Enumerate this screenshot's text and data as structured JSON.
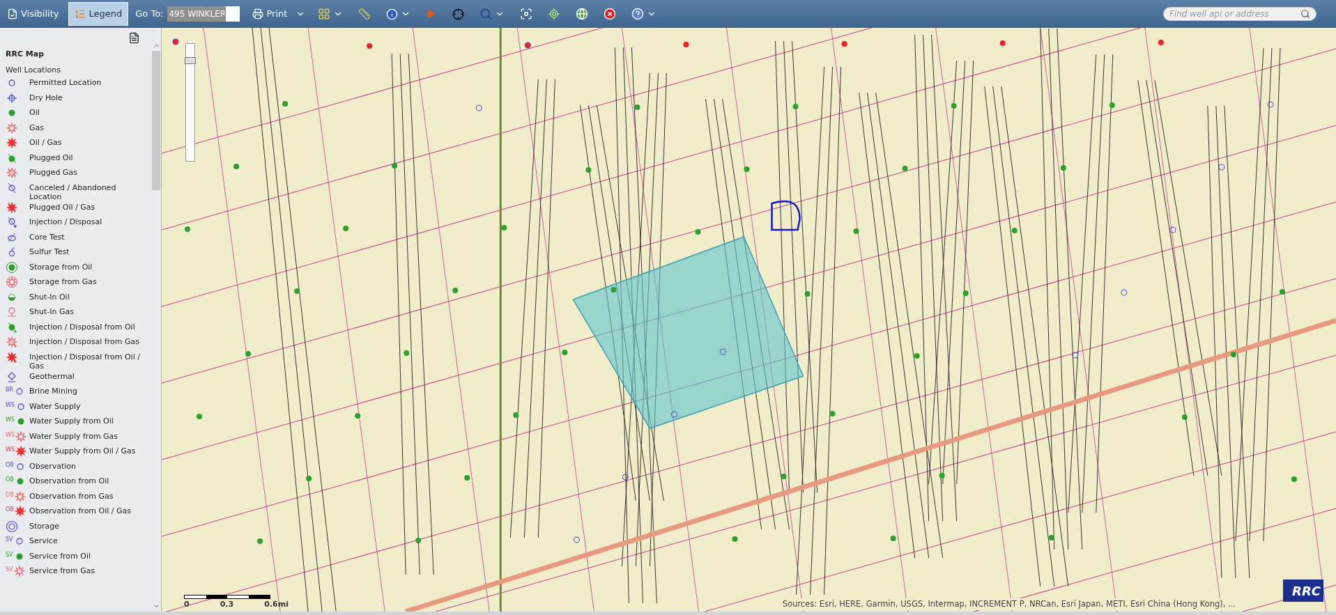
{
  "toolbar": {
    "tabs": [
      {
        "label": "Visibility",
        "kind": "visibility",
        "selected": false
      },
      {
        "label": "Legend",
        "kind": "legend",
        "selected": true
      }
    ],
    "goto": {
      "label": "Go To:",
      "value": "495 WINKLER"
    },
    "print": {
      "label": "Print",
      "has_menu": true
    },
    "tools": [
      {
        "kind": "grid",
        "has_menu": true
      },
      {
        "kind": "ruler",
        "has_menu": false
      },
      {
        "kind": "info",
        "has_menu": true
      },
      {
        "kind": "flag",
        "has_menu": false
      },
      {
        "kind": "crosshair",
        "has_menu": false
      },
      {
        "kind": "zoom",
        "has_menu": true
      },
      {
        "kind": "target",
        "has_menu": false
      },
      {
        "kind": "locate",
        "has_menu": false
      },
      {
        "kind": "globe",
        "has_menu": false
      },
      {
        "kind": "close",
        "has_menu": false
      },
      {
        "kind": "help",
        "has_menu": true
      }
    ],
    "search": {
      "placeholder": "Find well api or address"
    }
  },
  "legend": {
    "title": "RRC Map",
    "group": "Well Locations",
    "items": [
      {
        "label": "Permitted Location",
        "kind": "circle"
      },
      {
        "label": "Dry Hole",
        "kind": "dry"
      },
      {
        "label": "Oil",
        "kind": "oil"
      },
      {
        "label": "Gas",
        "kind": "gas"
      },
      {
        "label": "Oil / Gas",
        "kind": "oilgas"
      },
      {
        "label": "Plugged Oil",
        "kind": "plugged-oil"
      },
      {
        "label": "Plugged Gas",
        "kind": "plugged-gas"
      },
      {
        "label": "Canceled / Abandoned Location",
        "kind": "canceled"
      },
      {
        "label": "Plugged Oil / Gas",
        "kind": "plugged-oilgas"
      },
      {
        "label": "Injection / Disposal",
        "kind": "injection"
      },
      {
        "label": "Core Test",
        "kind": "core"
      },
      {
        "label": "Sulfur Test",
        "kind": "sulfur"
      },
      {
        "label": "Storage from Oil",
        "kind": "storage-oil"
      },
      {
        "label": "Storage from Gas",
        "kind": "storage-gas"
      },
      {
        "label": "Shut-In Oil",
        "kind": "shutin-oil"
      },
      {
        "label": "Shut-In Gas",
        "kind": "shutin-gas"
      },
      {
        "label": "Injection / Disposal from Oil",
        "kind": "inj-oil"
      },
      {
        "label": "Injection / Disposal from Gas",
        "kind": "inj-gas"
      },
      {
        "label": "Injection / Disposal from Oil / Gas",
        "kind": "inj-oilgas"
      },
      {
        "label": "Geothermal",
        "kind": "geothermal"
      },
      {
        "label": "Brine Mining",
        "kind": "circle",
        "tag": "BR"
      },
      {
        "label": "Water Supply",
        "kind": "circle",
        "tag": "WS"
      },
      {
        "label": "Water Supply from Oil",
        "kind": "oil",
        "tag": "WS"
      },
      {
        "label": "Water Supply from Gas",
        "kind": "gas",
        "tag": "WS"
      },
      {
        "label": "Water Supply from Oil / Gas",
        "kind": "oilgas",
        "tag": "WS"
      },
      {
        "label": "Observation",
        "kind": "circle",
        "tag": "OB"
      },
      {
        "label": "Observation from Oil",
        "kind": "oil",
        "tag": "OB"
      },
      {
        "label": "Observation from Gas",
        "kind": "gas",
        "tag": "OB"
      },
      {
        "label": "Observation from Oil / Gas",
        "kind": "oilgas",
        "tag": "OB"
      },
      {
        "label": "Storage",
        "kind": "storage"
      },
      {
        "label": "Service",
        "kind": "circle",
        "tag": "SV"
      },
      {
        "label": "Service from Oil",
        "kind": "oil",
        "tag": "SV"
      },
      {
        "label": "Service from Gas",
        "kind": "gas",
        "tag": "SV"
      }
    ]
  },
  "map": {
    "zoom_slider": {
      "level": 0.88
    },
    "scale_bar": {
      "ticks": [
        "0",
        "0.3",
        "0.6mi"
      ]
    },
    "attribution": "Sources: Esri, HERE, Garmin, USGS, Intermap, INCREMENT P, NRCan, Esri Japan, METI, Esri China (Hong Kong), ...",
    "logo": "RRC"
  }
}
